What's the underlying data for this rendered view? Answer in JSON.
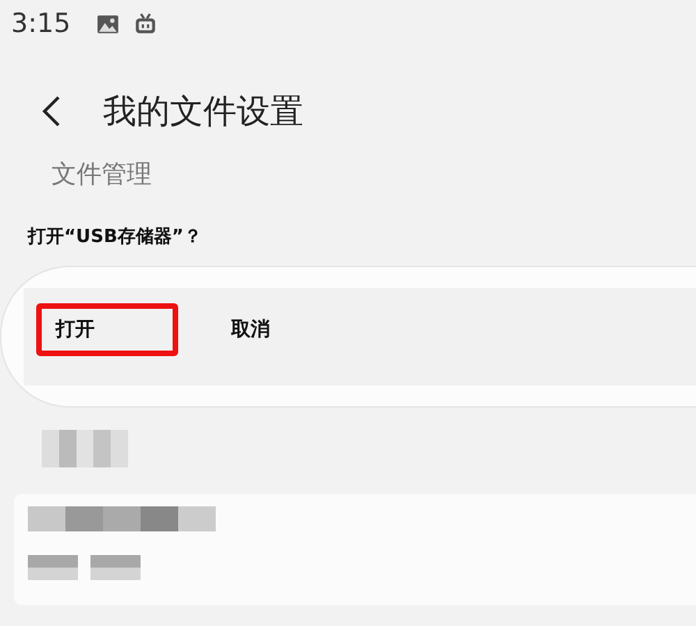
{
  "status_bar": {
    "time": "3:15"
  },
  "header": {
    "title": "我的文件设置"
  },
  "section": {
    "title": "文件管理"
  },
  "dialog": {
    "question": "打开“USB存储器”？",
    "buttons": [
      {
        "label": "打开",
        "highlighted": true
      },
      {
        "label": "取消",
        "highlighted": false
      }
    ]
  }
}
